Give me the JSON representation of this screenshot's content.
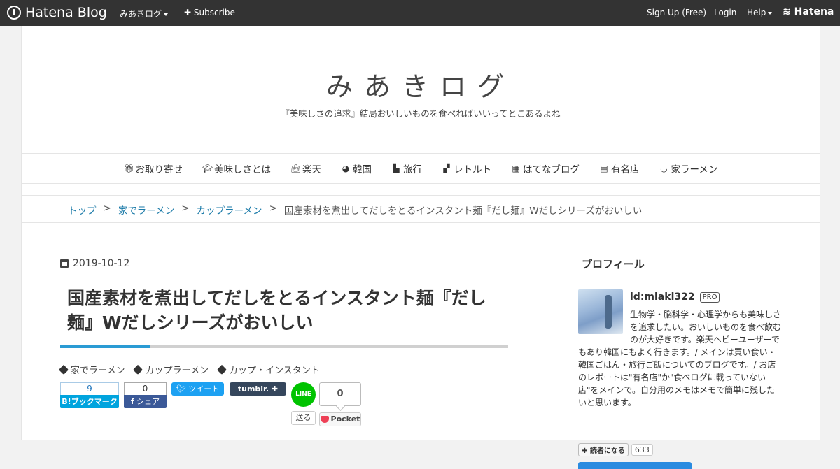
{
  "topbar": {
    "logo_text": "Hatena Blog",
    "blog_menu": "みあきログ",
    "subscribe": "Subscribe",
    "signup": "Sign Up (Free)",
    "login": "Login",
    "help": "Help",
    "hatena": "Hatena"
  },
  "header": {
    "title": "みあきログ",
    "description": "『美味しさの追求』結局おいしいものを食べればいいってとこあるよね"
  },
  "nav": {
    "items": [
      {
        "label": "お取り寄せ",
        "icon": "gift-icon"
      },
      {
        "label": "美味しさとは",
        "icon": "graduation-cap-icon"
      },
      {
        "label": "楽天",
        "icon": "shopping-bag-icon"
      },
      {
        "label": "韓国",
        "icon": "globe-icon"
      },
      {
        "label": "旅行",
        "icon": "map-icon"
      },
      {
        "label": "レトルト",
        "icon": "cubes-icon"
      },
      {
        "label": "はてなブログ",
        "icon": "calendar-icon"
      },
      {
        "label": "有名店",
        "icon": "archive-icon"
      },
      {
        "label": "家ラーメン",
        "icon": "bowl-icon"
      }
    ]
  },
  "breadcrumb": {
    "items": [
      "トップ",
      "家でラーメン",
      "カップラーメン"
    ],
    "separator": ">",
    "current": "国産素材を煮出してだしをとるインスタント麺『だし麺』Wだしシリーズがおいしい"
  },
  "post": {
    "date": "2019-10-12",
    "title": "国産素材を煮出してだしをとるインスタント麺『だし麺』Wだしシリーズがおいしい",
    "categories": [
      "家でラーメン",
      "カップラーメン",
      "カップ・インスタント"
    ]
  },
  "share": {
    "hatebu_count": "9",
    "hatebu_label": "B!ブックマーク",
    "facebook_count": "0",
    "facebook_label": "シェア",
    "twitter_label": "ツイート",
    "tumblr_label": "tumblr. ✚",
    "line_icon": "LINE",
    "line_label": "送る",
    "pocket_count": "0",
    "pocket_label": "Pocket"
  },
  "sidebar": {
    "profile_title": "プロフィール",
    "user_id": "id:miaki322",
    "pro_badge": "PRO",
    "description": "生物学・脳科学・心理学からも美味しさを追求したい。おいしいものを食べ飲むのが大好きです。楽天ヘビーユーザーでもあり韓国にもよく行きます。/ メインは買い食い・韓国ごはん・旅行ご飯についてのブログです。/ お店のレポートは\"有名店\"か\"食べログに載っていない店\"をメインで。自分用のメモはメモで簡単に残したいと思います。",
    "desc_lines": [
      "生物学・脳科学・心理学からも美味しさ",
      "を追求したい。おいしいものを食べ飲む",
      "のが大好きです。楽天ヘビーユーザーで",
      "もあり韓国にもよく行きます。/ メインは買い食い・",
      "韓国ごはん・旅行ご飯についてのブログです。/ お店",
      "のレポートは\"有名店\"か\"食べログに載っていない",
      "店\"をメインで。自分用のメモはメモで簡単に残した",
      "いと思います。"
    ],
    "reader_button": "✚ 読者になる",
    "reader_count": "633"
  }
}
